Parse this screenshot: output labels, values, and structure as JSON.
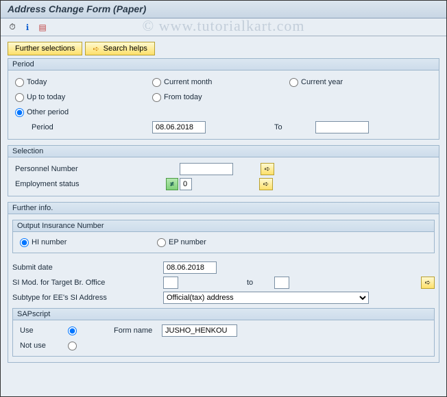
{
  "title": "Address Change Form (Paper)",
  "watermark": "© www.tutorialkart.com",
  "toolbar_icons": [
    "⏱",
    "ℹ",
    "▤"
  ],
  "buttons": {
    "further_selections": "Further selections",
    "search_helps": "Search helps"
  },
  "period": {
    "title": "Period",
    "today": "Today",
    "current_month": "Current month",
    "current_year": "Current year",
    "up_to_today": "Up to today",
    "from_today": "From today",
    "other_period": "Other period",
    "period_label": "Period",
    "period_from": "08.06.2018",
    "to_label": "To",
    "period_to": ""
  },
  "selection": {
    "title": "Selection",
    "personnel_number_label": "Personnel Number",
    "personnel_number": "",
    "employment_status_label": "Employment status",
    "employment_status": "0"
  },
  "further": {
    "title": "Further info.",
    "output_ins_title": "Output Insurance Number",
    "hi_number": "HI number",
    "ep_number": "EP number",
    "submit_date_label": "Submit date",
    "submit_date": "08.06.2018",
    "si_mod_label": "SI Mod. for Target Br. Office",
    "si_mod_from": "",
    "si_mod_to_label": "to",
    "si_mod_to": "",
    "subtype_label": "Subtype for EE's SI Address",
    "subtype_value": "Official(tax) address",
    "sapscript_title": "SAPscript",
    "use_label": "Use",
    "not_use_label": "Not use",
    "form_name_label": "Form name",
    "form_name": "JUSHO_HENKOU"
  }
}
